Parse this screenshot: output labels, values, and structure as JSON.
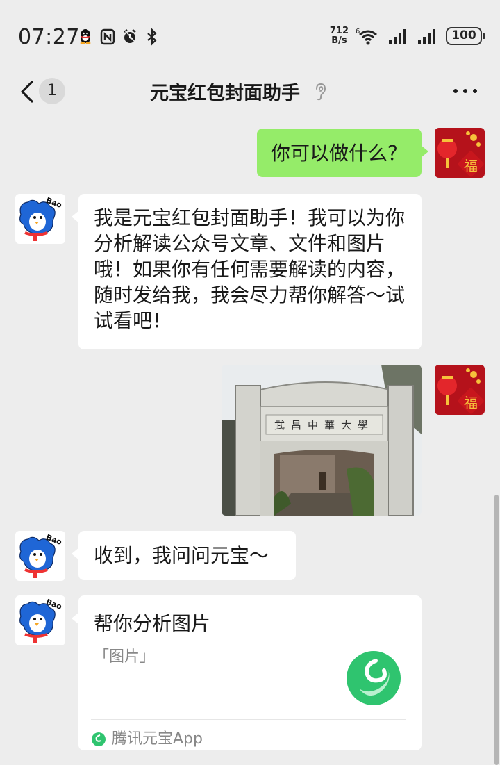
{
  "status_bar": {
    "time": "07:27",
    "net_speed_value": "712",
    "net_speed_unit": "B/s",
    "battery": "100",
    "icons": [
      "qq-icon",
      "nfc-icon",
      "alarm-icon",
      "bluetooth-icon",
      "wifi-icon",
      "signal-icon",
      "signal-icon",
      "battery-icon"
    ]
  },
  "header": {
    "unread_count": "1",
    "title": "元宝红包封面助手"
  },
  "messages": [
    {
      "side": "right",
      "type": "text",
      "text": "你可以做什么？"
    },
    {
      "side": "left",
      "type": "text",
      "text": "我是元宝红包封面助手！我可以为你分析解读公众号文章、文件和图片哦！如果你有任何需要解读的内容，随时发给我，我会尽力帮你解答～试试看吧！"
    },
    {
      "side": "right",
      "type": "image",
      "caption": "武昌中華大學"
    },
    {
      "side": "left",
      "type": "text",
      "text": "收到，我问问元宝～"
    },
    {
      "side": "left",
      "type": "card",
      "title": "帮你分析图片",
      "subtitle": "「图片」",
      "source": "腾讯元宝App"
    }
  ],
  "colors": {
    "background": "#ededed",
    "bubble_self": "#95ec69",
    "bubble_other": "#ffffff",
    "yuanbao_green": "#2fc46f"
  }
}
